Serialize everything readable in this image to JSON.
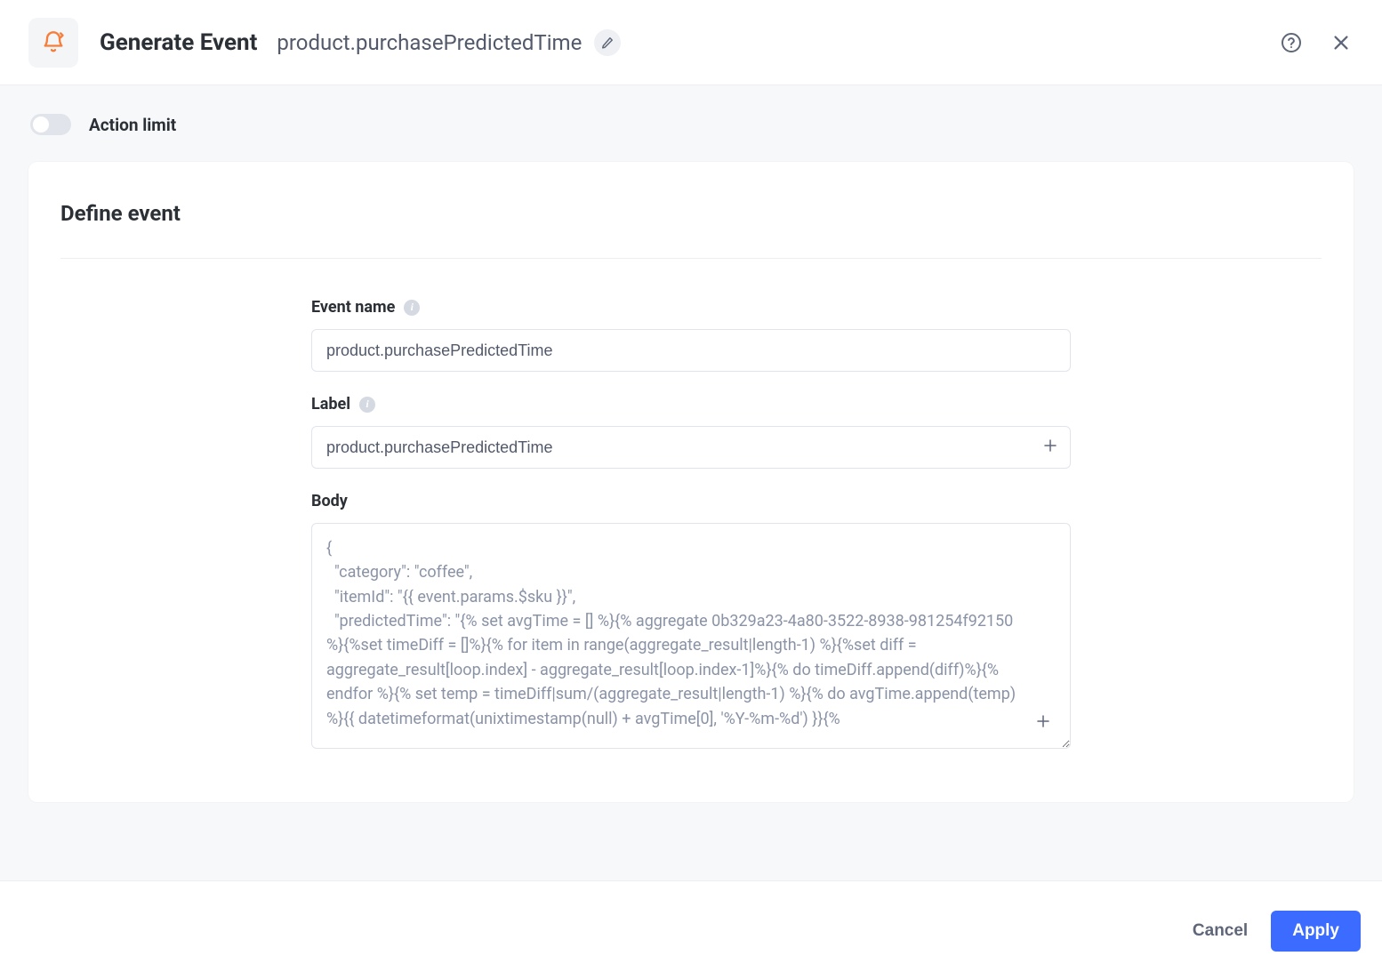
{
  "header": {
    "title": "Generate Event",
    "subtitle": "product.purchasePredictedTime"
  },
  "action_limit": {
    "label": "Action limit",
    "enabled": false
  },
  "card": {
    "title": "Define event"
  },
  "form": {
    "event_name": {
      "label": "Event name",
      "value": "product.purchasePredictedTime"
    },
    "label_field": {
      "label": "Label",
      "value": "product.purchasePredictedTime"
    },
    "body": {
      "label": "Body",
      "value": "{\n  \"category\": \"coffee\",\n  \"itemId\": \"{{ event.params.$sku }}\",\n  \"predictedTime\": \"{% set avgTime = [] %}{% aggregate 0b329a23-4a80-3522-8938-981254f92150 %}{%set timeDiff = []%}{% for item in range(aggregate_result|length-1) %}{%set diff = aggregate_result[loop.index] - aggregate_result[loop.index-1]%}{% do timeDiff.append(diff)%}{% endfor %}{% set temp = timeDiff|sum/(aggregate_result|length-1) %}{% do avgTime.append(temp) %}{{ datetimeformat(unixtimestamp(null) + avgTime[0], '%Y-%m-%d') }}{%"
    }
  },
  "footer": {
    "cancel_label": "Cancel",
    "apply_label": "Apply"
  }
}
